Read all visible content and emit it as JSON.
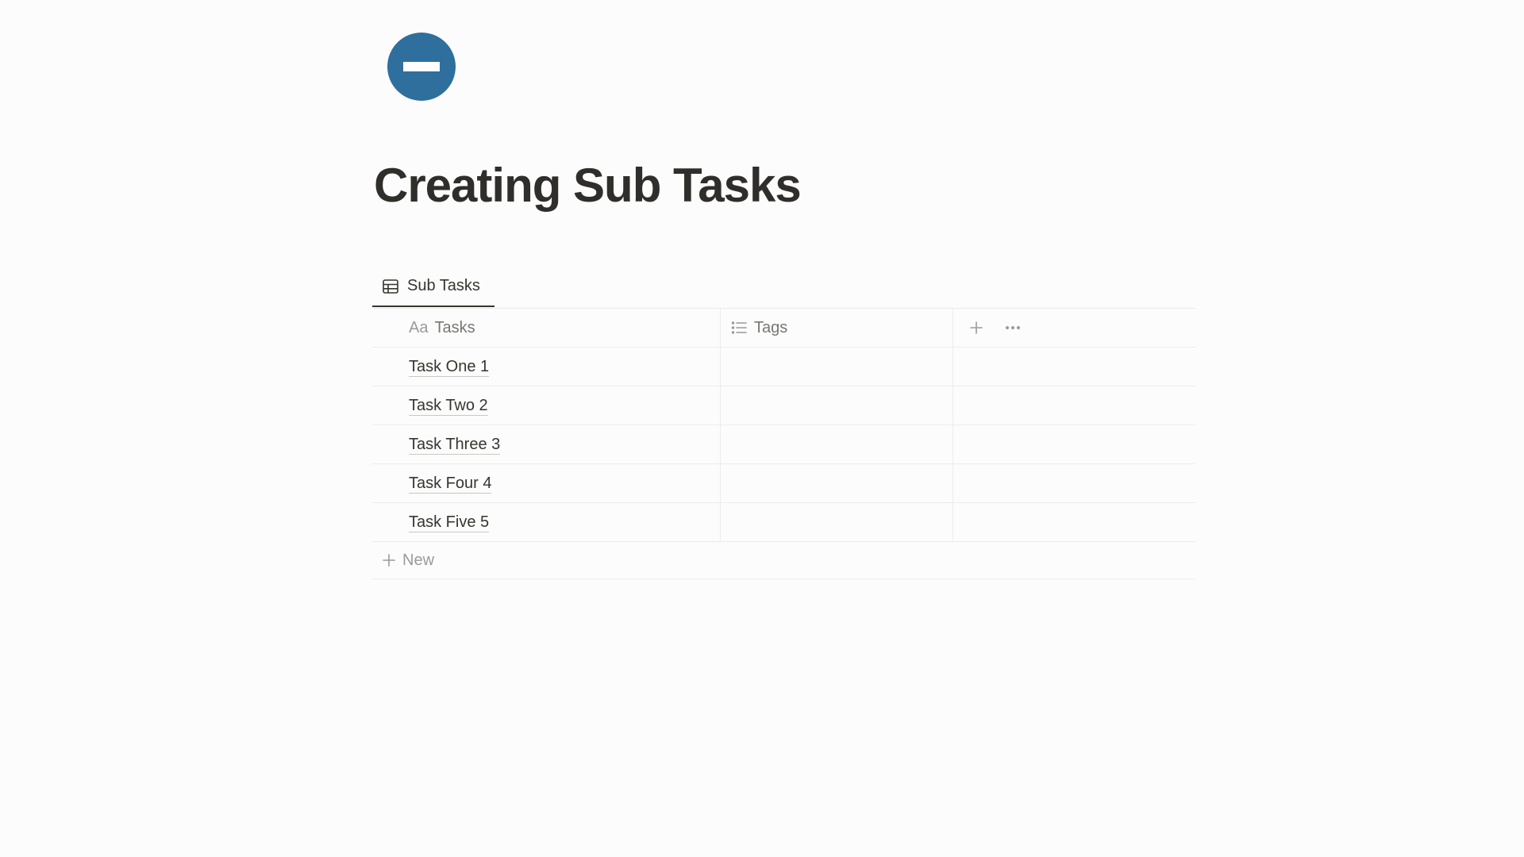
{
  "page": {
    "title": "Creating Sub Tasks",
    "icon": "minus-circle-icon",
    "icon_color": "#2e6f9e"
  },
  "database": {
    "view_tab": {
      "icon": "table-icon",
      "label": "Sub Tasks"
    },
    "columns": [
      {
        "icon": "text-aa-icon",
        "icon_text": "Aa",
        "label": "Tasks"
      },
      {
        "icon": "list-icon",
        "label": "Tags"
      }
    ],
    "header_actions": {
      "add_property_icon": "plus-icon",
      "more_icon": "ellipsis-icon"
    },
    "rows": [
      {
        "title": "Task One 1",
        "tags": ""
      },
      {
        "title": "Task Two 2",
        "tags": ""
      },
      {
        "title": "Task Three 3",
        "tags": ""
      },
      {
        "title": "Task Four 4",
        "tags": ""
      },
      {
        "title": "Task Five 5",
        "tags": ""
      }
    ],
    "new_row_label": "New"
  }
}
